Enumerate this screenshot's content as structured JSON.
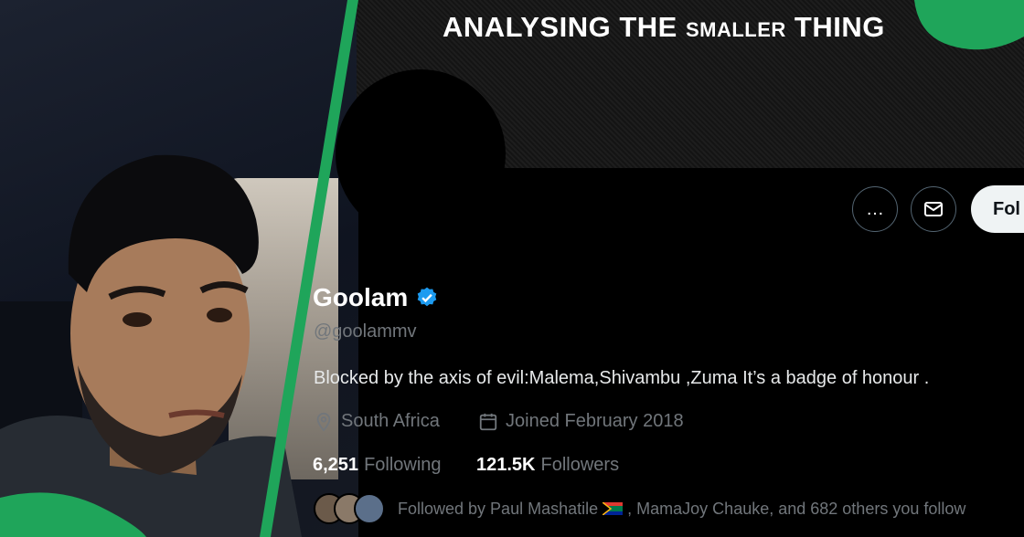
{
  "banner": {
    "title_main": "ANALYSING THE ",
    "title_small": "SMALLER",
    "title_end": " THING"
  },
  "profile": {
    "name": "Goolam",
    "handle": "@goolammv",
    "bio": "Blocked by the axis of evil:Malema,Shivambu ,Zuma  It’s a badge of honour .",
    "location": "South Africa",
    "joined": "Joined February 2018",
    "following_count": "6,251",
    "following_label": "Following",
    "followers_count": "121.5K",
    "followers_label": "Followers",
    "followed_by_prefix": "Followed by Paul Mashatile",
    "followed_by_suffix": ", MamaJoy Chauke, and 682 others you follow"
  },
  "actions": {
    "more_icon": "…",
    "follow_label": "Fol"
  },
  "colors": {
    "verified": "#1d9bf0",
    "accent_green": "#1fa55a",
    "muted": "#71767b"
  }
}
